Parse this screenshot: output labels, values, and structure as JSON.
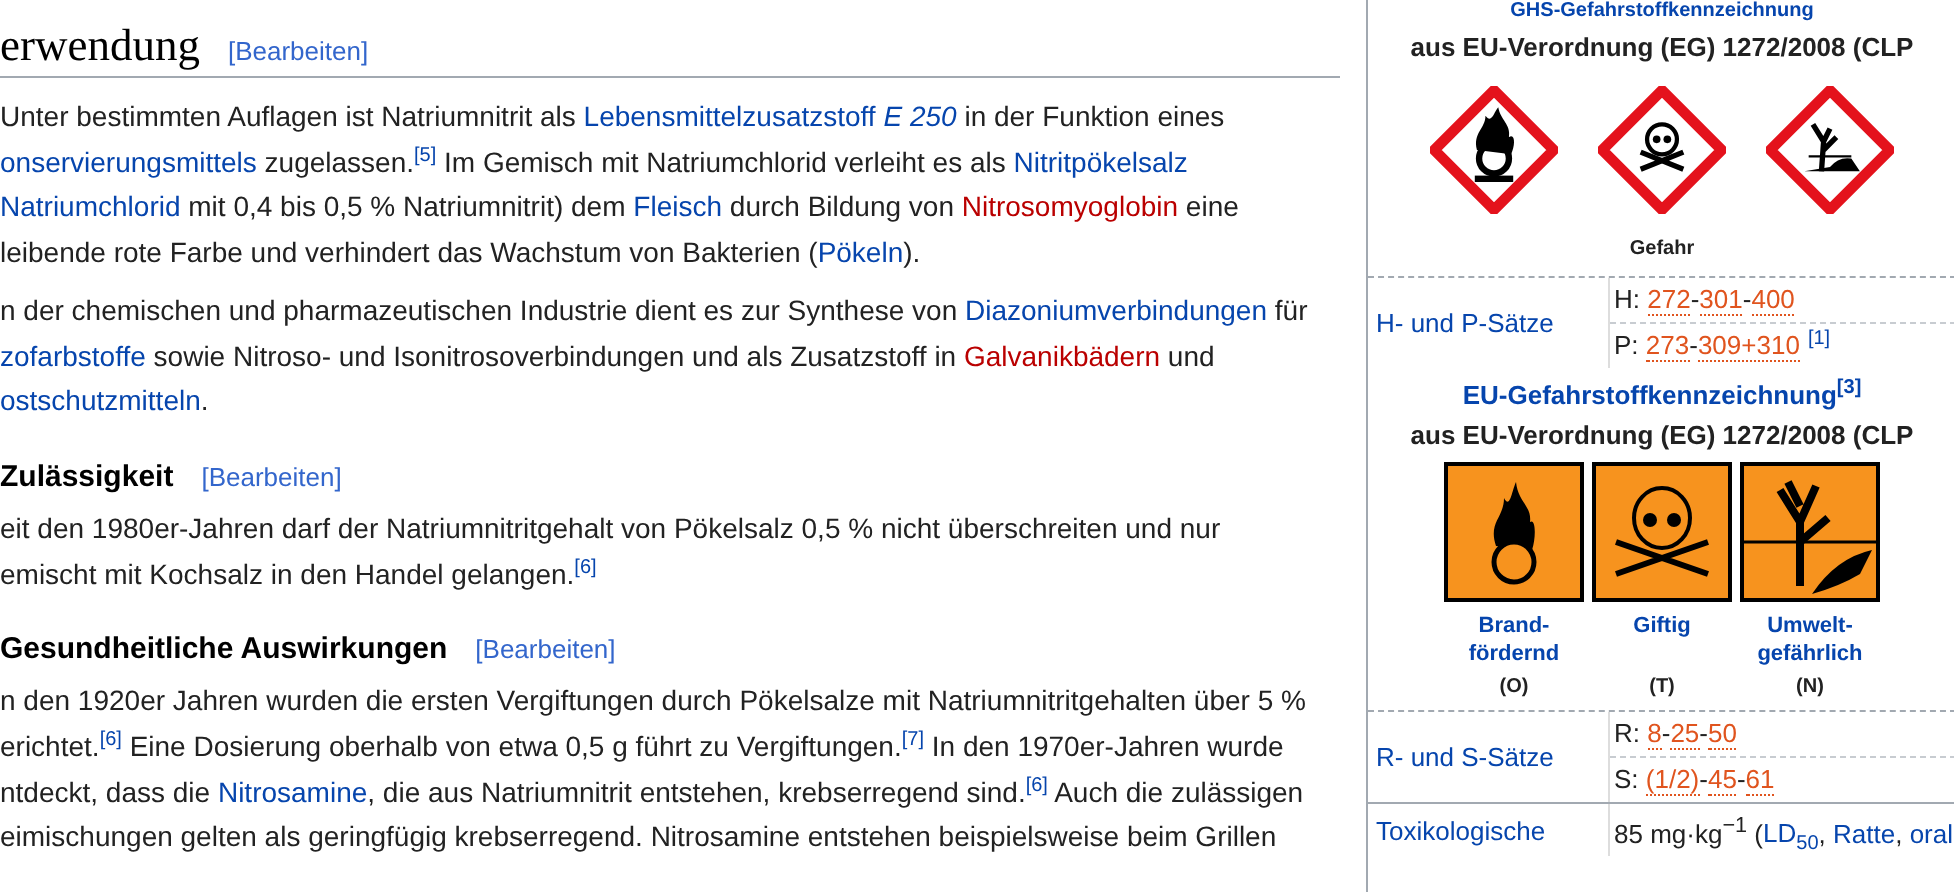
{
  "article": {
    "sections": [
      {
        "heading": "erwendung",
        "kind": "section",
        "edit": "[Bearbeiten]",
        "paragraphs": [
          {
            "lines": [
              [
                {
                  "kind": "text",
                  "text": "Unter bestimmten Auflagen ist Natriumnitrit als "
                },
                {
                  "kind": "link",
                  "text": "Lebensmittelzusatzstoff *E 250*"
                },
                {
                  "kind": "text",
                  "text": " in der Funktion eines"
                }
              ],
              [
                {
                  "kind": "link",
                  "text": "onservierungsmittels"
                },
                {
                  "kind": "text",
                  "text": " zugelassen."
                },
                {
                  "kind": "ref",
                  "text": "[5]"
                },
                {
                  "kind": "text",
                  "text": " Im Gemisch mit Natriumchlorid verleiht es als "
                },
                {
                  "kind": "link",
                  "text": "Nitritpökelsalz"
                }
              ],
              [
                {
                  "kind": "link",
                  "text": "Natriumchlorid"
                },
                {
                  "kind": "text",
                  "text": " mit 0,4 bis 0,5 % Natriumnitrit) dem "
                },
                {
                  "kind": "link",
                  "text": "Fleisch"
                },
                {
                  "kind": "text",
                  "text": " durch Bildung von "
                },
                {
                  "kind": "redlink",
                  "text": "Nitrosomyoglobin"
                },
                {
                  "kind": "text",
                  "text": " eine"
                }
              ],
              [
                {
                  "kind": "text",
                  "text": "leibende rote Farbe und verhindert das Wachstum von Bakterien ("
                },
                {
                  "kind": "link",
                  "text": "Pökeln"
                },
                {
                  "kind": "text",
                  "text": ")."
                }
              ]
            ]
          },
          {
            "lines": [
              [
                {
                  "kind": "text",
                  "text": "n der chemischen und pharmazeutischen Industrie dient es zur Synthese von "
                },
                {
                  "kind": "link",
                  "text": "Diazoniumverbindungen"
                },
                {
                  "kind": "text",
                  "text": " für"
                }
              ],
              [
                {
                  "kind": "link",
                  "text": "zofarbstoffe"
                },
                {
                  "kind": "text",
                  "text": " sowie Nitroso- und Isonitrosoverbindungen und als Zusatzstoff in "
                },
                {
                  "kind": "redlink",
                  "text": "Galvanikbädern"
                },
                {
                  "kind": "text",
                  "text": " und"
                }
              ],
              [
                {
                  "kind": "link",
                  "text": "ostschutzmitteln"
                },
                {
                  "kind": "text",
                  "text": "."
                }
              ]
            ]
          }
        ]
      },
      {
        "heading": "Zulässigkeit",
        "kind": "subsection",
        "edit": "[Bearbeiten]",
        "paragraphs": [
          {
            "lines": [
              [
                {
                  "kind": "text",
                  "text": "eit den 1980er-Jahren darf der Natriumnitritgehalt von Pökelsalz 0,5 % nicht überschreiten und nur"
                }
              ],
              [
                {
                  "kind": "text",
                  "text": "emischt mit Kochsalz in den Handel gelangen."
                },
                {
                  "kind": "ref",
                  "text": "[6]"
                }
              ]
            ]
          }
        ]
      },
      {
        "heading": "Gesundheitliche Auswirkungen",
        "kind": "subsection",
        "edit": "[Bearbeiten]",
        "paragraphs": [
          {
            "lines": [
              [
                {
                  "kind": "text",
                  "text": "n den 1920er Jahren wurden die ersten Vergiftungen durch Pökelsalze mit Natriumnitritgehalten über 5 %"
                }
              ],
              [
                {
                  "kind": "text",
                  "text": "erichtet."
                },
                {
                  "kind": "ref",
                  "text": "[6]"
                },
                {
                  "kind": "text",
                  "text": " Eine Dosierung oberhalb von etwa 0,5 g führt zu Vergiftungen."
                },
                {
                  "kind": "ref",
                  "text": "[7]"
                },
                {
                  "kind": "text",
                  "text": " In den 1970er-Jahren wurde"
                }
              ],
              [
                {
                  "kind": "text",
                  "text": "ntdeckt, dass die "
                },
                {
                  "kind": "link",
                  "text": "Nitrosamine"
                },
                {
                  "kind": "text",
                  "text": ", die aus Natriumnitrit entstehen, krebserregend sind."
                },
                {
                  "kind": "ref",
                  "text": "[6]"
                },
                {
                  "kind": "text",
                  "text": " Auch die zulässigen"
                }
              ],
              [
                {
                  "kind": "text",
                  "text": "eimischungen gelten als geringfügig krebserregend. Nitrosamine entstehen beispielsweise beim Grillen"
                }
              ]
            ]
          }
        ]
      }
    ]
  },
  "infobox": {
    "blocks": [
      {
        "kind": "ghs",
        "title": "GHS-Gefahrstoffkennzeichnung",
        "subtitle": "aus EU-Verordnung (EG) 1272/2008 (CLP",
        "pictograms": [
          {
            "kind": "oxidizing"
          },
          {
            "kind": "toxic"
          },
          {
            "kind": "environment"
          }
        ],
        "signal": "Gefahr"
      },
      {
        "kind": "phrases",
        "label": "H- und P-Sätze",
        "lines": [
          [
            {
              "kind": "text",
              "text": "H: "
            },
            {
              "kind": "code",
              "text": "272"
            },
            {
              "kind": "text",
              "text": "-"
            },
            {
              "kind": "code",
              "text": "301"
            },
            {
              "kind": "text",
              "text": "-"
            },
            {
              "kind": "code",
              "text": "400"
            }
          ],
          [
            {
              "kind": "text",
              "text": "P: "
            },
            {
              "kind": "code",
              "text": "273"
            },
            {
              "kind": "text",
              "text": "-"
            },
            {
              "kind": "code",
              "text": "309+310"
            },
            {
              "kind": "ref",
              "text": "[1]"
            }
          ]
        ]
      },
      {
        "kind": "eu",
        "title": "EU-Gefahrstoffkennzeichnung",
        "title_ref": "[3]",
        "subtitle": "aus EU-Verordnung (EG) 1272/2008 (CLP",
        "pictograms": [
          {
            "kind": "oxidizing",
            "label": "Brand-\nfördernd",
            "code": "(O)"
          },
          {
            "kind": "toxic",
            "label": "Giftig",
            "code": "(T)"
          },
          {
            "kind": "environment",
            "label": "Umwelt-\ngefährlich",
            "code": "(N)"
          }
        ]
      },
      {
        "kind": "phrases",
        "label": "R- und S-Sätze",
        "lines": [
          [
            {
              "kind": "text",
              "text": "R: "
            },
            {
              "kind": "code",
              "text": "8"
            },
            {
              "kind": "text",
              "text": "-"
            },
            {
              "kind": "code",
              "text": "25"
            },
            {
              "kind": "text",
              "text": "-"
            },
            {
              "kind": "code",
              "text": "50"
            }
          ],
          [
            {
              "kind": "text",
              "text": "S: "
            },
            {
              "kind": "code",
              "text": "(1/2)"
            },
            {
              "kind": "text",
              "text": "-"
            },
            {
              "kind": "code",
              "text": "45"
            },
            {
              "kind": "text",
              "text": "-"
            },
            {
              "kind": "code",
              "text": "61"
            }
          ]
        ]
      },
      {
        "kind": "data",
        "label": "Toxikologische",
        "lines": [
          [
            {
              "kind": "text",
              "text": "85 mg·kg$^{−1}$ ("
            },
            {
              "kind": "link",
              "text": "LD$_{50}$"
            },
            {
              "kind": "text",
              "text": ", "
            },
            {
              "kind": "link",
              "text": "Ratte"
            },
            {
              "kind": "text",
              "text": ", "
            },
            {
              "kind": "link",
              "text": "oral"
            }
          ]
        ]
      }
    ]
  }
}
